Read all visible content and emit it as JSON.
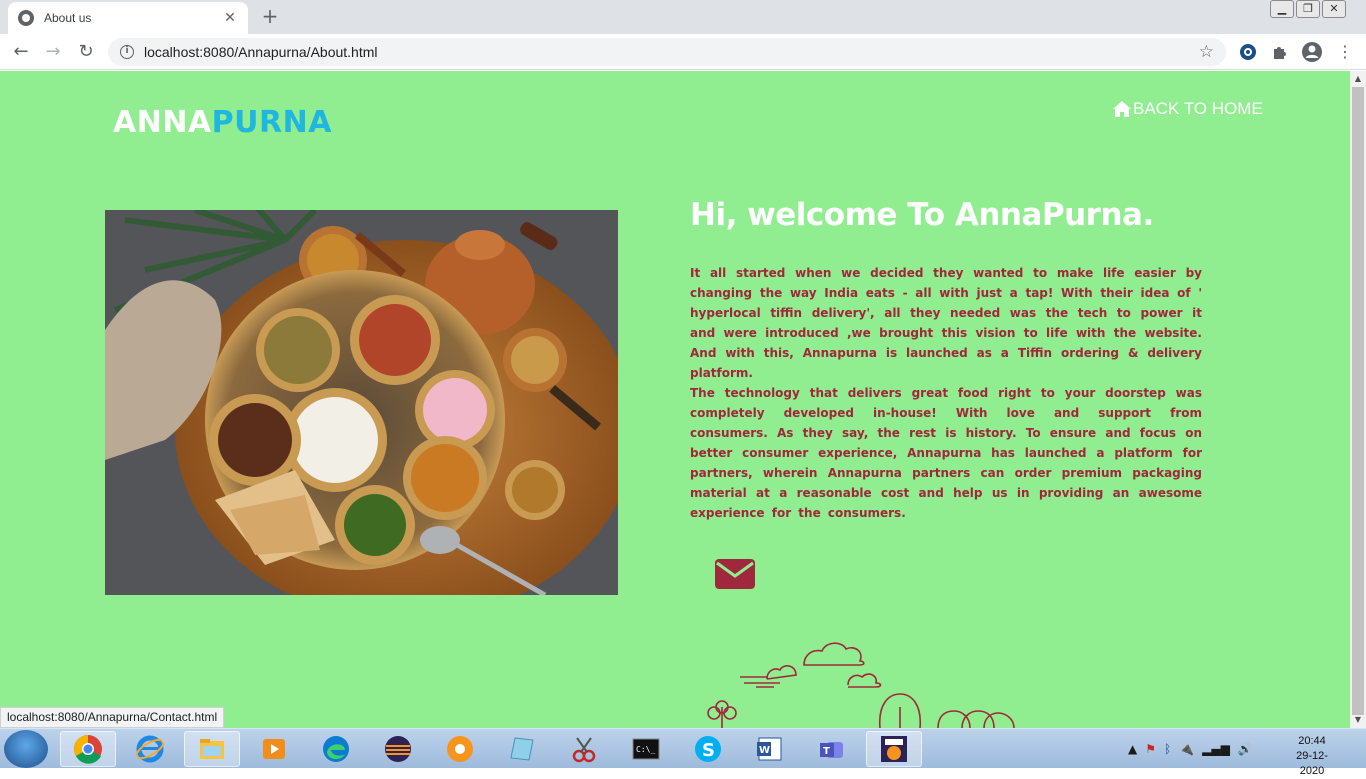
{
  "browser": {
    "tab_title": "About us",
    "url": "localhost:8080/Annapurna/About.html",
    "status_url": "localhost:8080/Annapurna/Contact.html"
  },
  "page": {
    "logo_part1": "ANNA",
    "logo_part2": "PURNA",
    "back_home": "BACK TO HOME",
    "heading": "Hi, welcome To AnnaPurna.",
    "paragraph1": "It all started when we decided they wanted to make life easier by changing the way India eats - all with just a tap! With their idea of ' hyperlocal tiffin delivery', all they needed was the tech to power it and were introduced ,we brought this vision to life with the website. And with this, Annapurna is launched as a Tiffin ordering & delivery platform.",
    "paragraph2": "The technology that delivers great food right to your doorstep was completely developed in-house! With love and support from consumers. As they say, the rest is history. To ensure and focus on better consumer experience, Annapurna has launched a platform for partners, wherein Annapurna partners can order premium packaging material at a reasonable cost and help us in providing an awesome experience for the consumers."
  },
  "colors": {
    "page_bg": "#90ee90",
    "logo_accent": "#1fb6e0",
    "text_maroon": "#a0283c"
  },
  "taskbar": {
    "apps": [
      "chrome-icon",
      "internet-explorer-icon",
      "file-explorer-icon",
      "media-player-icon",
      "edge-icon",
      "eclipse-icon",
      "app-icon",
      "notepad-icon",
      "snipping-tool-icon",
      "command-prompt-icon",
      "skype-icon",
      "word-icon",
      "teams-icon",
      "java-ee-ide-icon"
    ],
    "time": "20:44",
    "date": "29-12-2020"
  }
}
